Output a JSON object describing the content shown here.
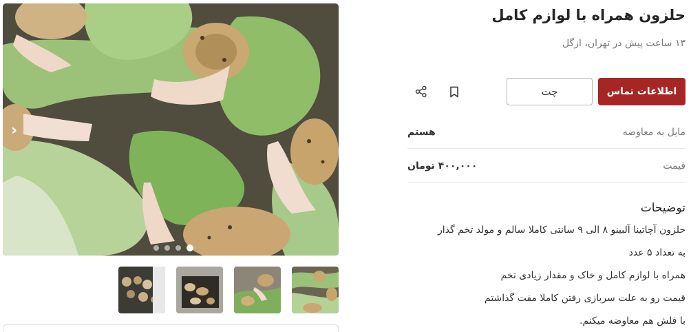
{
  "listing": {
    "title": "حلزون همراه با لوازم کامل",
    "subtitle": "۱۳ ساعت پیش در تهران، ازگل"
  },
  "actions": {
    "contact_label": "اطلاعات تماس",
    "chat_label": "چت",
    "bookmark_icon": "bookmark-icon",
    "share_icon": "share-icon"
  },
  "details": [
    {
      "key": "مایل به معاوضه",
      "value": "هستم"
    },
    {
      "key": "قیمت",
      "value": "۴۰۰,۰۰۰ تومان"
    }
  ],
  "description": {
    "title": "توضیحات",
    "lines": [
      "حلزون آچاتینا آلبینو ۸ الی ۹ سانتی کاملا سالم و مولد تخم گذار",
      "به تعداد ۵ عدد",
      "همراه با لوازم کامل و خاک و مقدار زیادی تخم",
      "قیمت رو به علت سربازی رفتن کاملا مفت گذاشتم",
      "با فلش هم معاوضه میکنم."
    ]
  },
  "gallery": {
    "next_arrow": "›",
    "dot_count": 4,
    "active_dot": 4,
    "colors": {
      "accent": "#a62626"
    }
  }
}
